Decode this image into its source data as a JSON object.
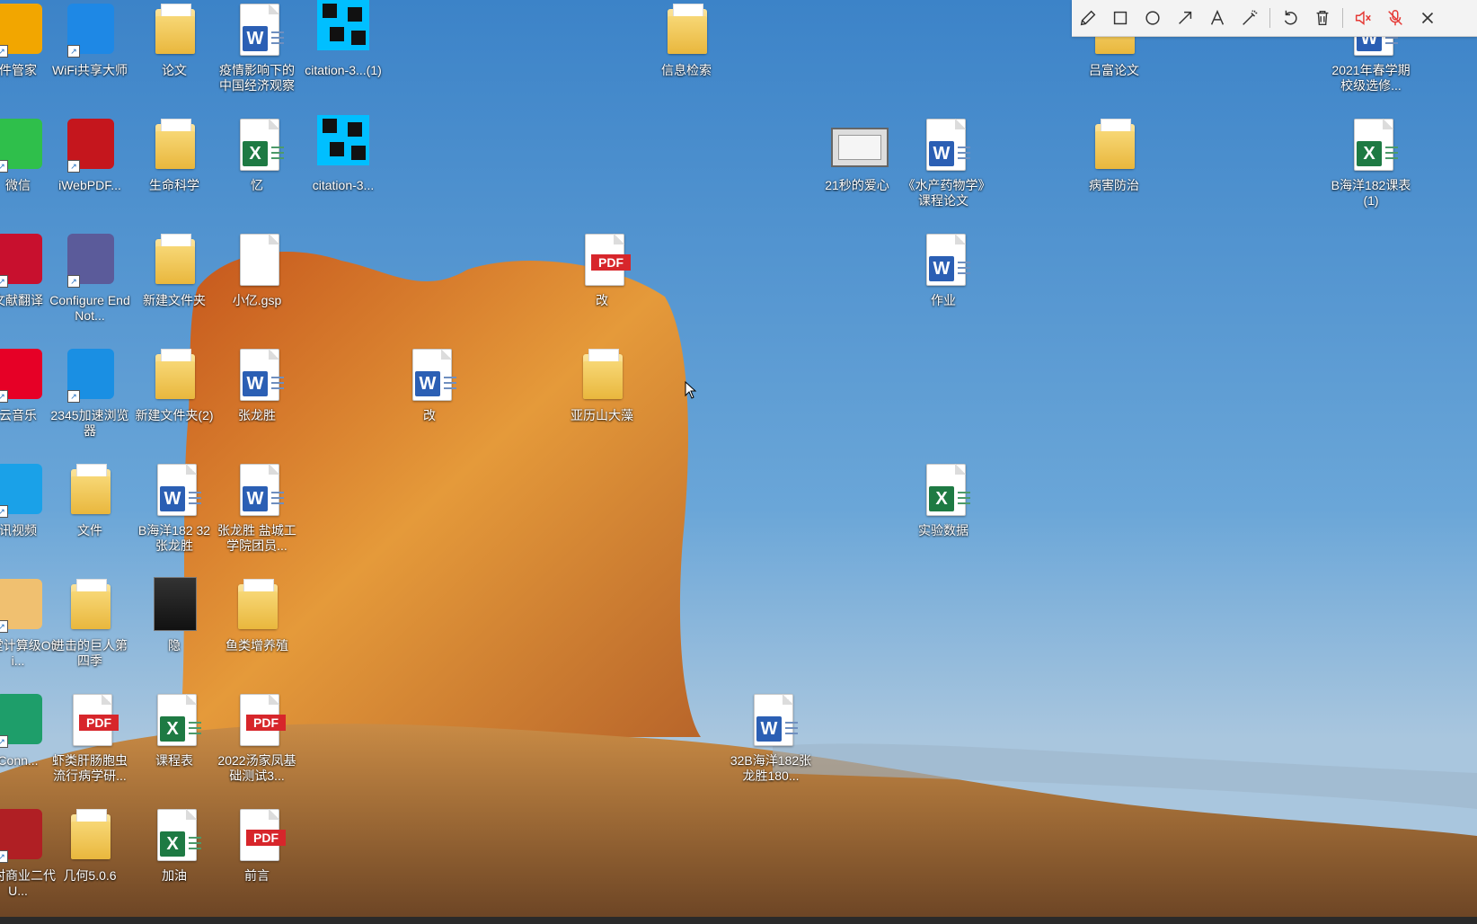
{
  "desktop": {
    "icons": [
      {
        "id": "pc-manager",
        "label": "件管家",
        "type": "app",
        "color": "#f2a600"
      },
      {
        "id": "wifi",
        "label": "WiFi共享大师",
        "type": "app",
        "color": "#1e88e5"
      },
      {
        "id": "lunwen",
        "label": "论文",
        "type": "folder"
      },
      {
        "id": "yiqing",
        "label": "疫情影响下的中国经济观察",
        "type": "word"
      },
      {
        "id": "citation1",
        "label": "citation-3...(1)",
        "type": "mosaic"
      },
      {
        "id": "xinxi",
        "label": "信息检索",
        "type": "folder"
      },
      {
        "id": "lvfu",
        "label": "吕富论文",
        "type": "folder"
      },
      {
        "id": "chunxue",
        "label": "2021年春学期校级选修...",
        "type": "word"
      },
      {
        "id": "weixin",
        "label": "微信",
        "type": "app",
        "color": "#2fbf4b"
      },
      {
        "id": "iwebpdf",
        "label": "iWebPDF...",
        "type": "app",
        "color": "#c5161d"
      },
      {
        "id": "shengming",
        "label": "生命科学",
        "type": "folder"
      },
      {
        "id": "yi",
        "label": "忆",
        "type": "excel"
      },
      {
        "id": "citation2",
        "label": "citation-3...",
        "type": "mosaic"
      },
      {
        "id": "aixin",
        "label": "21秒的爱心",
        "type": "video"
      },
      {
        "id": "shuichan",
        "label": "《水产药物学》课程论文",
        "type": "word"
      },
      {
        "id": "binghai",
        "label": "病害防治",
        "type": "folder"
      },
      {
        "id": "kebiao1",
        "label": "B海洋182课表(1)",
        "type": "excel"
      },
      {
        "id": "fanyi",
        "label": "文献翻译",
        "type": "app",
        "color": "#c8102e"
      },
      {
        "id": "endnote",
        "label": "Configure EndNot...",
        "type": "app",
        "color": "#5b5b9a"
      },
      {
        "id": "xinjian1",
        "label": "新建文件夹",
        "type": "folder"
      },
      {
        "id": "xiaoyi",
        "label": "小亿.gsp",
        "type": "blank"
      },
      {
        "id": "gai-pdf",
        "label": "改",
        "type": "pdf"
      },
      {
        "id": "zuoye",
        "label": "作业",
        "type": "word"
      },
      {
        "id": "yunyinyue",
        "label": "云音乐",
        "type": "app",
        "color": "#e60026"
      },
      {
        "id": "browser2345",
        "label": "2345加速浏览器",
        "type": "app",
        "color": "#1a8fe3"
      },
      {
        "id": "xinjian2",
        "label": "新建文件夹(2)",
        "type": "folder"
      },
      {
        "id": "zhanglong",
        "label": "张龙胜",
        "type": "word"
      },
      {
        "id": "gai-word",
        "label": "改",
        "type": "word"
      },
      {
        "id": "yalishan",
        "label": "亚历山大藻",
        "type": "folder"
      },
      {
        "id": "shipin",
        "label": "讯视频",
        "type": "app",
        "color": "#1aa1e8"
      },
      {
        "id": "wenjian",
        "label": "文件",
        "type": "folder"
      },
      {
        "id": "bhaiyang",
        "label": "B海洋182 32张龙胜",
        "type": "word"
      },
      {
        "id": "yancheng",
        "label": "张龙胜 盐城工学院团员...",
        "type": "word"
      },
      {
        "id": "shiyan",
        "label": "实验数据",
        "type": "excel"
      },
      {
        "id": "ketang",
        "label": "课堂计算级Offi...",
        "type": "app",
        "color": "#f0c070"
      },
      {
        "id": "jinji",
        "label": "进击的巨人第四季",
        "type": "folder"
      },
      {
        "id": "yin",
        "label": "隐",
        "type": "image"
      },
      {
        "id": "yulei",
        "label": "鱼类增养殖",
        "type": "folder"
      },
      {
        "id": "conn",
        "label": "Conn...",
        "type": "app",
        "color": "#1e9e6a"
      },
      {
        "id": "xialei",
        "label": "虾类肝肠胞虫流行病学研...",
        "type": "pdf"
      },
      {
        "id": "kechengbiao",
        "label": "课程表",
        "type": "excel"
      },
      {
        "id": "tangjiafeng",
        "label": "2022汤家凤基础测试3...",
        "type": "pdf"
      },
      {
        "id": "32b",
        "label": "32B海洋182张龙胜180...",
        "type": "word"
      },
      {
        "id": "nongshang",
        "label": "农村商业二代U...",
        "type": "app",
        "color": "#b01f24"
      },
      {
        "id": "jihe",
        "label": "几何5.0.6",
        "type": "folder"
      },
      {
        "id": "jiayou",
        "label": "加油",
        "type": "excel"
      },
      {
        "id": "qianyan",
        "label": "前言",
        "type": "pdf"
      }
    ]
  },
  "toolbar": {
    "tools": [
      {
        "id": "pencil",
        "icon": "pencil-icon"
      },
      {
        "id": "rect",
        "icon": "rectangle-icon"
      },
      {
        "id": "circle",
        "icon": "circle-icon"
      },
      {
        "id": "arrow",
        "icon": "arrow-icon"
      },
      {
        "id": "text",
        "icon": "text-icon"
      },
      {
        "id": "magic",
        "icon": "magic-wand-icon"
      },
      {
        "id": "undo",
        "icon": "undo-icon"
      },
      {
        "id": "delete",
        "icon": "trash-icon"
      },
      {
        "id": "speaker",
        "icon": "speaker-muted-icon"
      },
      {
        "id": "mic",
        "icon": "mic-muted-icon"
      },
      {
        "id": "close",
        "icon": "close-icon"
      }
    ],
    "accent_muted": "#e53935"
  }
}
